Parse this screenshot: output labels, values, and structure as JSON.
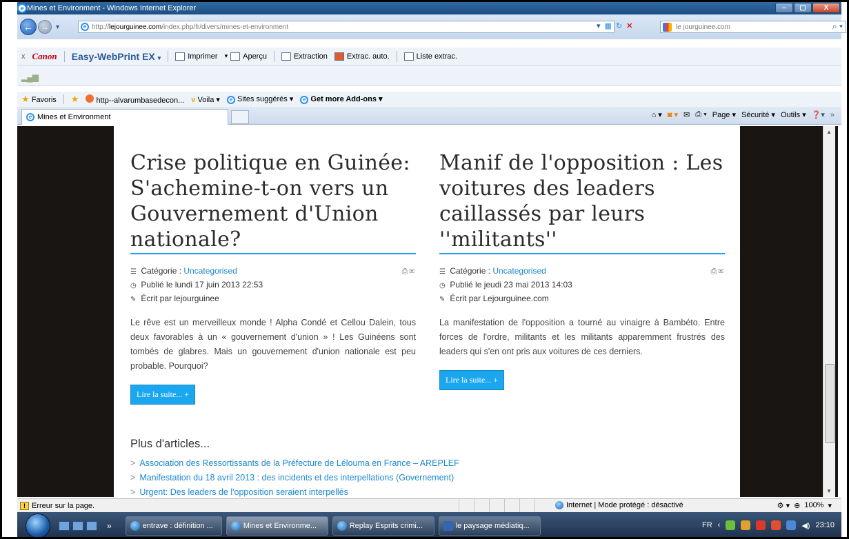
{
  "window": {
    "title": "Mines et Environment - Windows Internet Explorer",
    "controls": [
      "–",
      "▢",
      "X"
    ]
  },
  "address": {
    "prefix": "http://",
    "host": "lejourguinee.com",
    "path": "/index.php/fr/divers/mines-et-environment",
    "search_placeholder": "le jourguinee.com"
  },
  "canon_toolbar": {
    "close": "x",
    "brand": "Canon",
    "product": "Easy-WebPrint EX",
    "print": "Imprimer",
    "preview": "Aperçu",
    "extraction": "Extraction",
    "auto_extraction": "Extrac. auto.",
    "extraction_list": "Liste extrac."
  },
  "favorites_bar": {
    "favorites": "Favoris",
    "link1": "http--alvarumbasedecon...",
    "voila": "Voila",
    "suggested": "Sites suggérés",
    "addons": "Get more Add-ons"
  },
  "tabs": {
    "active": "Mines et Environment"
  },
  "command_bar": {
    "page": "Page",
    "security": "Sécurité",
    "tools": "Outils"
  },
  "articles": [
    {
      "title": "Crise politique en Guinée: S'achemine-t-on vers un Gouvernement d'Union nationale?",
      "category_label": "Catégorie : ",
      "category": "Uncategorised",
      "published": "Publié le lundi 17 juin 2013 22:53",
      "author": "Écrit par lejourguinee",
      "intro": "Le rêve est un merveilleux monde ! Alpha Condé et Cellou Dalein, tous deux favorables à un « gouvernement d'union » ! Les Guinéens sont tombés de glabres. Mais un gouvernement d'union nationale est peu probable. Pourquoi?",
      "read_more": "Lire la suite...  +"
    },
    {
      "title": "Manif de l'opposition : Les voitures des leaders caillassés par leurs ''militants''",
      "category_label": "Catégorie : ",
      "category": "Uncategorised",
      "published": "Publié le jeudi 23 mai 2013 14:03",
      "author": "Écrit par Lejourguinee.com",
      "intro": "La manifestation de l'opposition a tourné au vinaigre à Bambéto. Entre forces de l'ordre, militants et les militants apparemment frustrés des leaders qui s'en ont pris aux voitures de ces derniers.",
      "read_more": "Lire la suite...  +"
    }
  ],
  "more_articles": {
    "heading": "Plus d'articles...",
    "items": [
      "Association des Ressortissants de la Préfecture de Lélouma en France – AREPLEF",
      "Manifestation du 18 avril 2013 : des incidents et des interpellations (Governement)",
      "Urgent: Des leaders de l'opposition seraient interpellés"
    ]
  },
  "status_bar": {
    "error": "Erreur sur la page.",
    "zone": "Internet | Mode protégé : désactivé",
    "zoom": "100%"
  },
  "taskbar": {
    "buttons": [
      "entrave : définition ...",
      "Mines et Environme...",
      "Replay Esprits crimi...",
      "le paysage médiatiq..."
    ],
    "lang": "FR",
    "time": "23:10"
  }
}
